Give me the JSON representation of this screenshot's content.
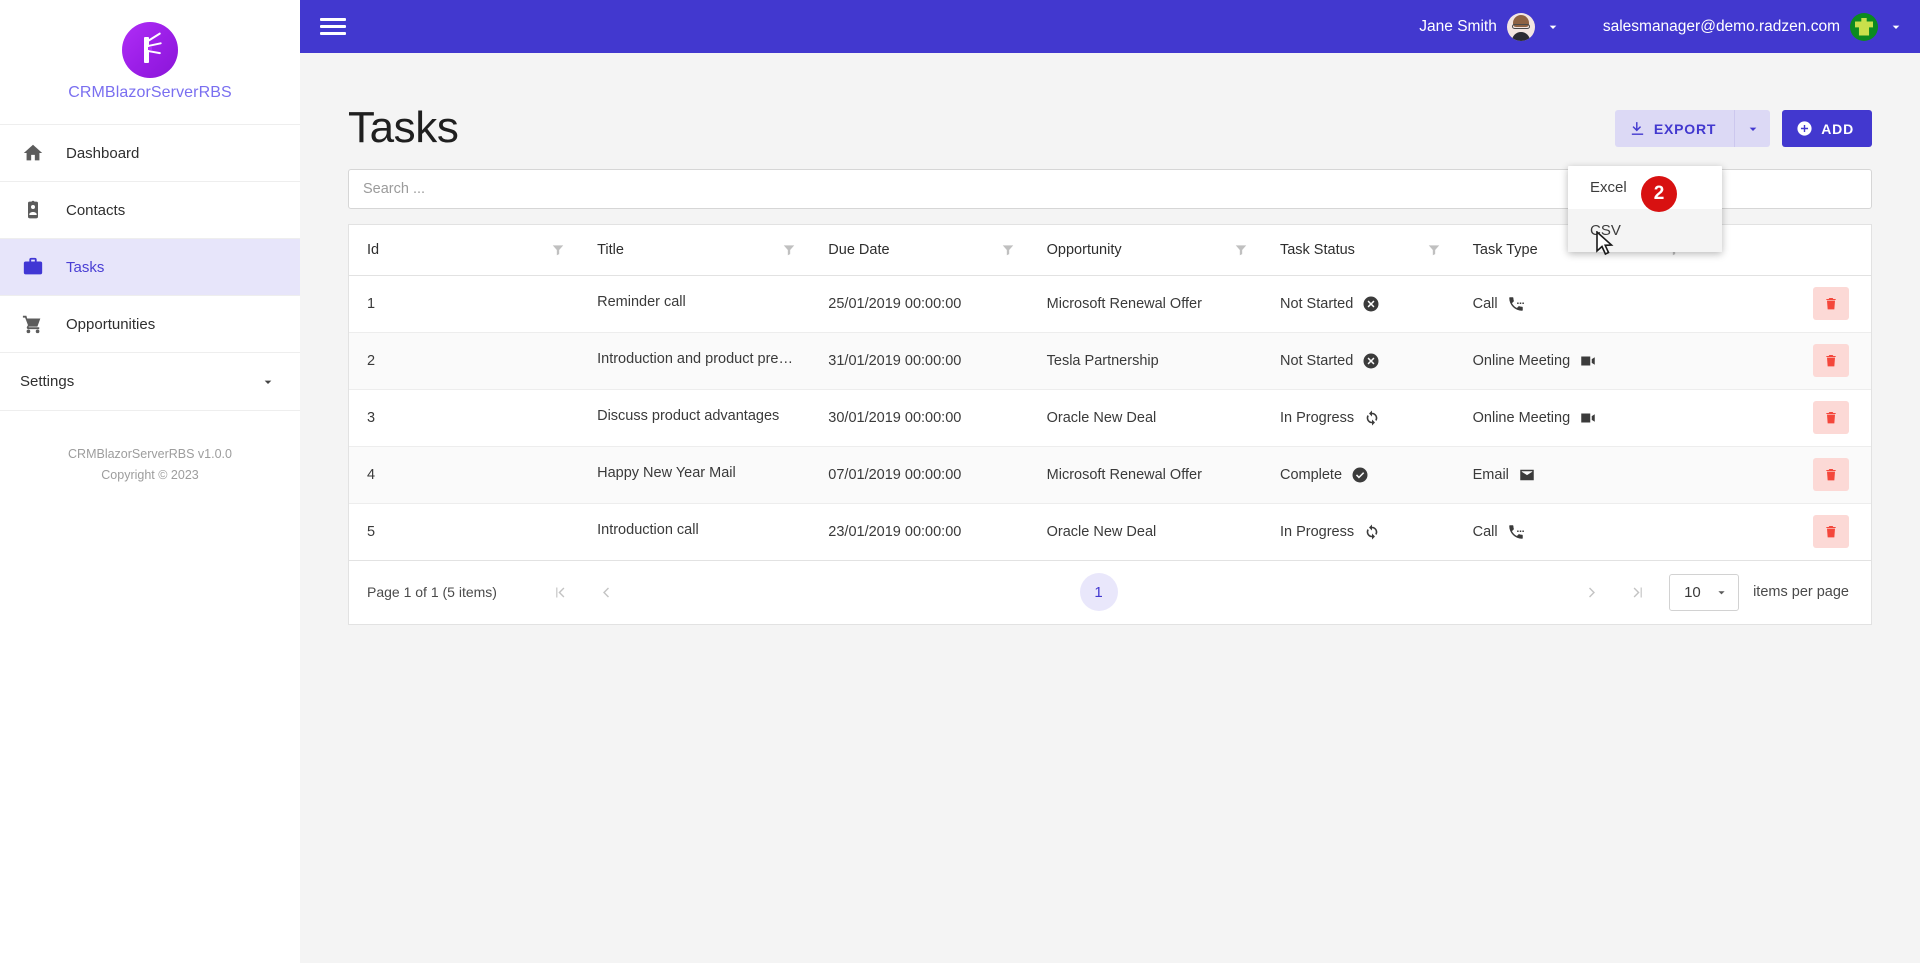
{
  "brand": {
    "logo_icon": "bamboo-k-logo-icon",
    "name": "CRMBlazorServerRBS",
    "footer_version": "CRMBlazorServerRBS v1.0.0",
    "footer_copyright": "Copyright © 2023"
  },
  "sidebar": {
    "items": [
      {
        "label": "Dashboard",
        "icon": "home-icon",
        "active": false
      },
      {
        "label": "Contacts",
        "icon": "contact-card-icon",
        "active": false
      },
      {
        "label": "Tasks",
        "icon": "briefcase-icon",
        "active": true
      },
      {
        "label": "Opportunities",
        "icon": "shopping-cart-icon",
        "active": false
      }
    ],
    "settings": {
      "label": "Settings",
      "icon": "chevron-down-icon"
    }
  },
  "topbar": {
    "menu_icon": "hamburger-menu-icon",
    "user_name": "Jane Smith",
    "user_avatar": "jane-smith-avatar",
    "account_email": "salesmanager@demo.radzen.com",
    "account_avatar": "green-puzzle-avatar",
    "caret_icon": "chevron-down-icon",
    "bg_color": "#4238cf"
  },
  "page": {
    "title": "Tasks",
    "export_label": "EXPORT",
    "export_icon": "download-icon",
    "export_caret_icon": "caret-down-icon",
    "add_label": "ADD",
    "add_icon": "plus-circle-icon",
    "accent_color": "#4238cf"
  },
  "export_menu": {
    "open": true,
    "items": [
      {
        "label": "Excel",
        "hovered": false
      },
      {
        "label": "CSV",
        "hovered": true
      }
    ]
  },
  "annotation": {
    "badge_number": "2",
    "badge_color": "#d81111",
    "cursor_icon": "mouse-pointer-icon"
  },
  "search": {
    "placeholder": "Search ...",
    "value": "",
    "icon": "search-input"
  },
  "table": {
    "columns": [
      {
        "label": "Id",
        "filter_icon": "filter-icon"
      },
      {
        "label": "Title",
        "filter_icon": "filter-icon"
      },
      {
        "label": "Due Date",
        "filter_icon": "filter-icon"
      },
      {
        "label": "Opportunity",
        "filter_icon": "filter-icon"
      },
      {
        "label": "Task Status",
        "filter_icon": "filter-icon"
      },
      {
        "label": "Task Type",
        "filter_icon": "filter-icon"
      }
    ],
    "rows": [
      {
        "id": "1",
        "title": "Reminder call",
        "due_date": "25/01/2019 00:00:00",
        "opportunity": "Microsoft Renewal Offer",
        "task_status": "Not Started",
        "task_status_icon": "cancel-circle-icon",
        "task_type": "Call",
        "task_type_icon": "phone-icon",
        "delete_icon": "trash-icon"
      },
      {
        "id": "2",
        "title": "Introduction and product pre…",
        "due_date": "31/01/2019 00:00:00",
        "opportunity": "Tesla Partnership",
        "task_status": "Not Started",
        "task_status_icon": "cancel-circle-icon",
        "task_type": "Online Meeting",
        "task_type_icon": "video-camera-icon",
        "delete_icon": "trash-icon"
      },
      {
        "id": "3",
        "title": "Discuss product advantages",
        "due_date": "30/01/2019 00:00:00",
        "opportunity": "Oracle New Deal",
        "task_status": "In Progress",
        "task_status_icon": "refresh-icon",
        "task_type": "Online Meeting",
        "task_type_icon": "video-camera-icon",
        "delete_icon": "trash-icon"
      },
      {
        "id": "4",
        "title": "Happy New Year Mail",
        "due_date": "07/01/2019 00:00:00",
        "opportunity": "Microsoft Renewal Offer",
        "task_status": "Complete",
        "task_status_icon": "check-circle-icon",
        "task_type": "Email",
        "task_type_icon": "envelope-icon",
        "delete_icon": "trash-icon"
      },
      {
        "id": "5",
        "title": "Introduction call",
        "due_date": "23/01/2019 00:00:00",
        "opportunity": "Oracle New Deal",
        "task_status": "In Progress",
        "task_status_icon": "refresh-icon",
        "task_type": "Call",
        "task_type_icon": "phone-icon",
        "delete_icon": "trash-icon"
      }
    ]
  },
  "pager": {
    "info": "Page 1 of 1 (5 items)",
    "first_icon": "first-page-icon",
    "prev_icon": "prev-page-icon",
    "next_icon": "next-page-icon",
    "last_icon": "last-page-icon",
    "current_page": "1",
    "page_size": "10",
    "page_size_caret": "caret-down-icon",
    "page_size_label": "items per page"
  }
}
